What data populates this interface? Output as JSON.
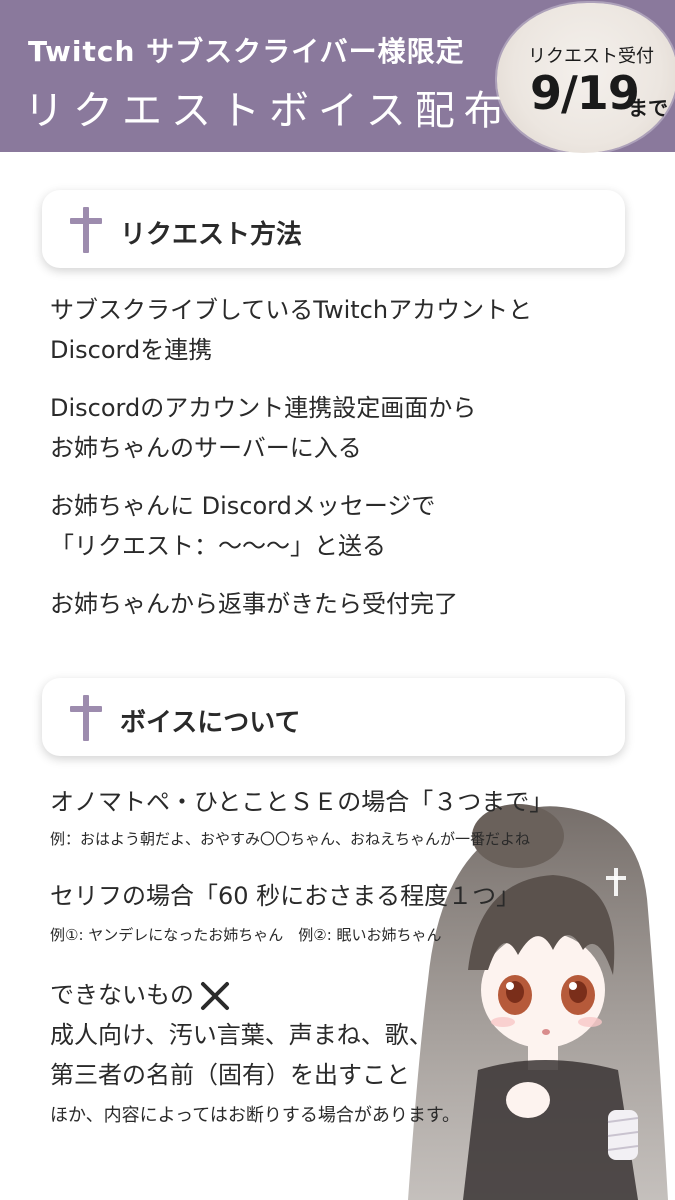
{
  "header": {
    "line1": "Twitch サブスクライバー様限定",
    "line2": "リクエストボイス配布",
    "background_color": "#8a799c"
  },
  "badge": {
    "label": "リクエスト受付",
    "date": "9/19",
    "suffix": "まで"
  },
  "request_section": {
    "title": "リクエスト方法",
    "icon": "cross-icon",
    "steps": [
      {
        "line1": "サブスクライブしているTwitchアカウントと",
        "line2": "Discordを連携"
      },
      {
        "line1": "Discordのアカウント連携設定画面から",
        "line2": "お姉ちゃんのサーバーに入る"
      },
      {
        "line1": "お姉ちゃんに Discordメッセージで",
        "line2": "「リクエスト：〜〜〜」と送る"
      },
      {
        "line1": "お姉ちゃんから返事がきたら受付完了"
      }
    ]
  },
  "voice_section": {
    "title": "ボイスについて",
    "icon": "cross-icon",
    "onomatopoeia": {
      "text": "オノマトペ・ひとことＳＥの場合「３つまで」",
      "example": "例：おはよう朝だよ、おやすみ〇〇ちゃん、おねえちゃんが一番だよね"
    },
    "serif": {
      "text": "セリフの場合「60 秒におさまる程度１つ」",
      "example": "例①: ヤンデレになったお姉ちゃん　例②: 眠いお姉ちゃん"
    },
    "cannot": {
      "title": "できないもの",
      "line1": "成人向け、汚い言葉、声まね、歌、",
      "line2": "第三者の名前（固有）を出すこと",
      "note": "ほか、内容によってはお断りする場合があります。"
    }
  },
  "accent_color": "#9d8cae"
}
